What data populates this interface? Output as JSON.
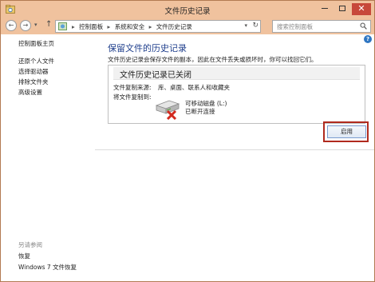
{
  "window": {
    "title": "文件历史记录"
  },
  "address": {
    "crumbs": [
      "控制面板",
      "系统和安全",
      "文件历史记录"
    ],
    "separator": "▸",
    "search_placeholder": "搜索控制面板"
  },
  "sidebar": {
    "items": [
      "控制面板主页",
      "还原个人文件",
      "选择驱动器",
      "排除文件夹",
      "高级设置"
    ],
    "see_also_header": "另请参阅",
    "see_also": [
      "恢复",
      "Windows 7 文件恢复"
    ]
  },
  "main": {
    "heading": "保留文件的历史记录",
    "description": "文件历史记录会保存文件的副本，因此在文件丢失或损坏时，你可以找回它们。",
    "panel": {
      "title": "文件历史记录已关闭",
      "source_label": "文件复制来源:",
      "source_value": "库、桌面、联系人和收藏夹",
      "target_label": "将文件复制到:",
      "drive_name": "可移动磁盘 (L:)",
      "drive_status": "已断开连接"
    },
    "enable_button": "启用"
  },
  "colors": {
    "titlebar": "#f0c29e",
    "heading": "#1e3e8c",
    "highlight": "#b02a1e",
    "close": "#c7483a"
  },
  "icons": {
    "app": "file-history-icon",
    "drive": "removable-drive-disconnected-icon",
    "help": "help-icon"
  }
}
